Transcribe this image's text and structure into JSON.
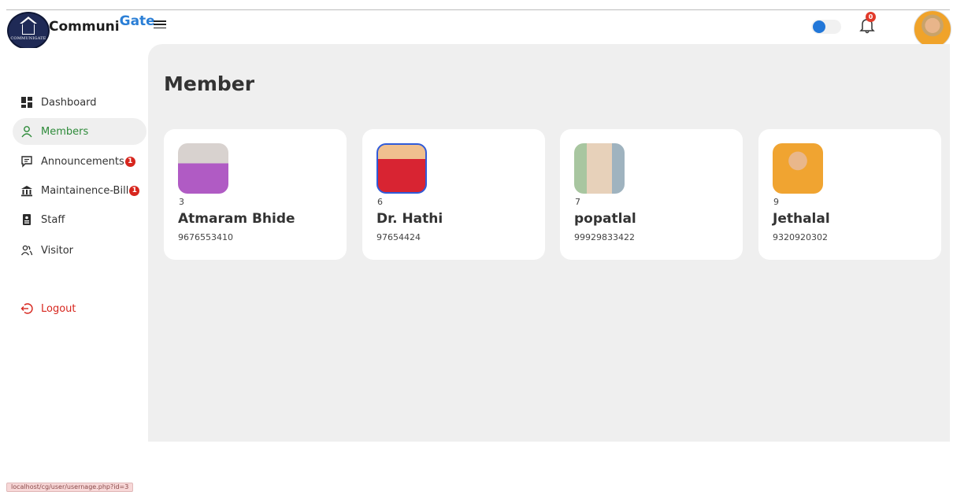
{
  "header": {
    "logo_text": "COMMUNIGATE",
    "brand_main": "Communi",
    "brand_accent": "Gate",
    "notification_count": "0"
  },
  "sidebar": {
    "items": [
      {
        "label": "Dashboard",
        "icon": "dashboard-icon"
      },
      {
        "label": "Members",
        "icon": "user-icon",
        "active": true
      },
      {
        "label": "Announcements",
        "icon": "message-icon",
        "badge": "1"
      },
      {
        "label": "Maintainence-Bill",
        "icon": "bank-icon",
        "badge": "1"
      },
      {
        "label": "Staff",
        "icon": "id-card-icon"
      },
      {
        "label": "Visitor",
        "icon": "users-icon"
      }
    ],
    "logout_label": "Logout"
  },
  "main": {
    "title": "Member",
    "members": [
      {
        "id": "3",
        "name": "Atmaram Bhide",
        "phone": "9676553410"
      },
      {
        "id": "6",
        "name": "Dr. Hathi",
        "phone": "97654424"
      },
      {
        "id": "7",
        "name": "popatlal",
        "phone": "99929833422"
      },
      {
        "id": "9",
        "name": "Jethalal",
        "phone": "9320920302"
      }
    ]
  },
  "status_bar": {
    "url": "localhost/cg/user/usernage.php?id=3"
  },
  "colors": {
    "accent_blue": "#2b7fd6",
    "active_green": "#2e8b3a",
    "badge_red": "#d7261e"
  }
}
